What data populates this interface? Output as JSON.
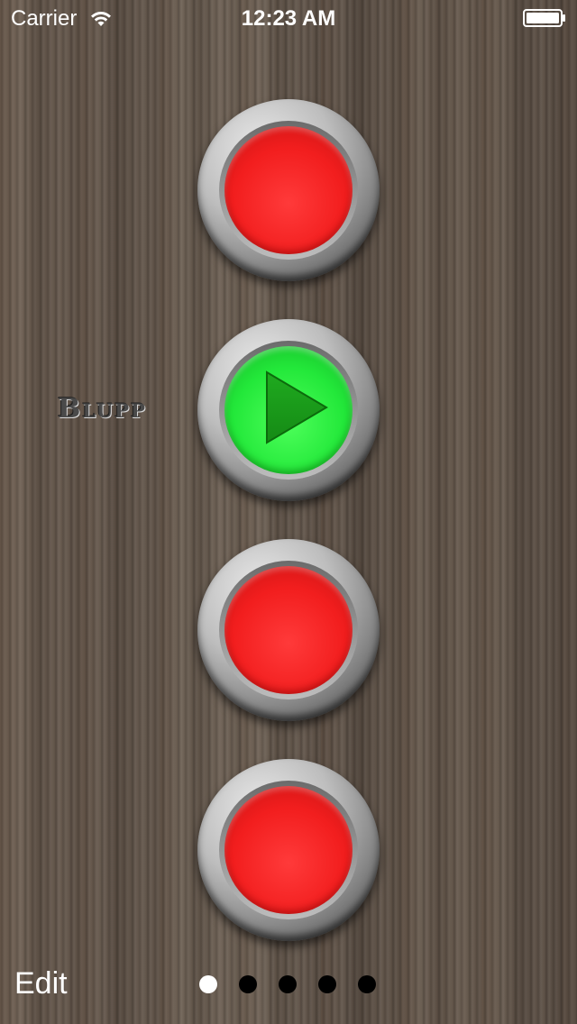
{
  "status_bar": {
    "carrier": "Carrier",
    "wifi_icon": "wifi-icon",
    "time": "12:23 AM",
    "battery_icon": "battery-icon"
  },
  "buttons": [
    {
      "state": "stopped",
      "color": "#f21e1e"
    },
    {
      "state": "playing",
      "color": "#23e83a",
      "label": "Blupp",
      "icon": "play-icon"
    },
    {
      "state": "stopped",
      "color": "#f21e1e"
    },
    {
      "state": "stopped",
      "color": "#f21e1e"
    }
  ],
  "edit_label": "Edit",
  "pager": {
    "page_count": 5,
    "current_page": 1,
    "active_color": "#ffffff",
    "inactive_color": "#000000"
  }
}
